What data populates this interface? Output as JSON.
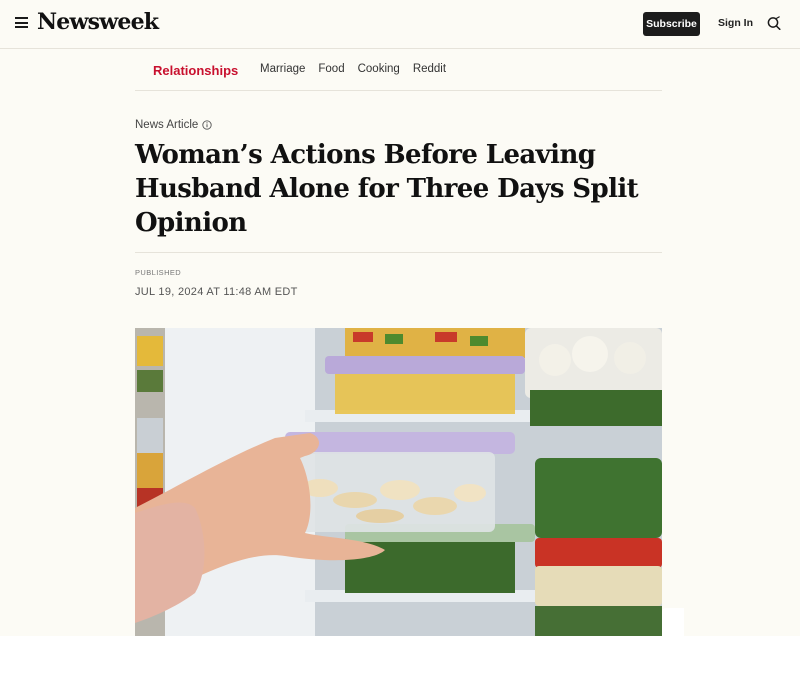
{
  "header": {
    "logo": "Newsweek",
    "subscribe_label": "Subscribe",
    "signin_label": "Sign In",
    "icons": [
      "menu-icon",
      "search-icon"
    ]
  },
  "subnav": {
    "primary": "Relationships",
    "items": [
      "Marriage",
      "Food",
      "Cooking",
      "Reddit"
    ]
  },
  "article": {
    "kicker": "News Article",
    "headline": "Woman’s Actions Before Leaving Husband Alone for Three Days Split Opinion",
    "published_label": "PUBLISHED",
    "published_date": "JUL 19, 2024 AT 11:48 AM EDT"
  },
  "colors": {
    "accent": "#c8102e",
    "background": "#fcfbf5",
    "button": "#1c1c1c"
  }
}
